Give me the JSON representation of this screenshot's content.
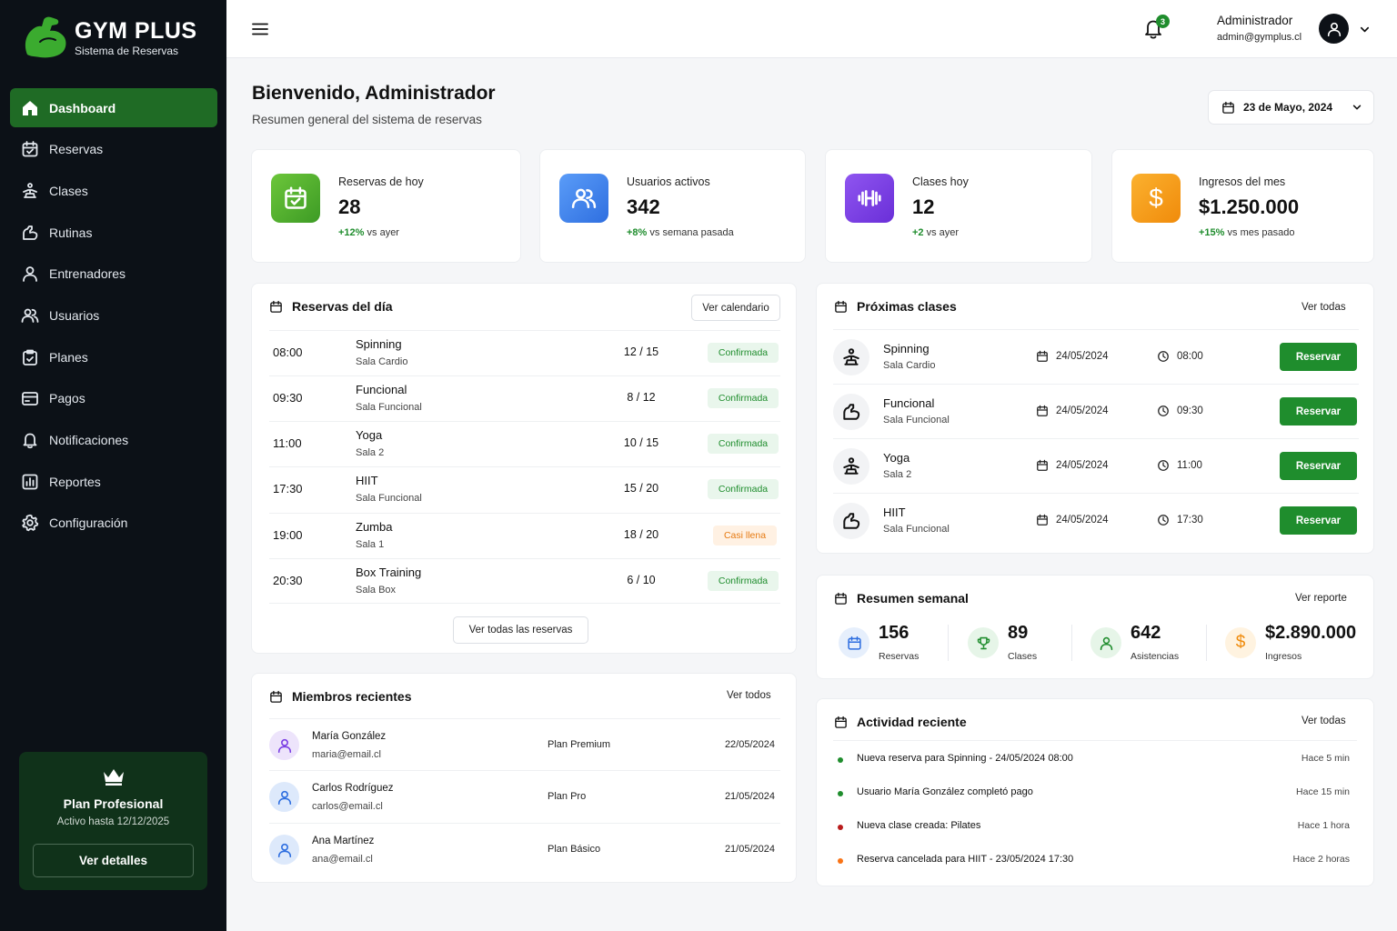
{
  "brand": {
    "title": "GYM PLUS",
    "subtitle": "Sistema de Reservas"
  },
  "sidebar": {
    "items": [
      {
        "label": "Dashboard",
        "icon": "home-icon"
      },
      {
        "label": "Reservas",
        "icon": "calendar-icon"
      },
      {
        "label": "Clases",
        "icon": "exercise-icon"
      },
      {
        "label": "Rutinas",
        "icon": "muscle-icon"
      },
      {
        "label": "Entrenadores",
        "icon": "user-icon"
      },
      {
        "label": "Usuarios",
        "icon": "users-icon"
      },
      {
        "label": "Planes",
        "icon": "clipboard-icon"
      },
      {
        "label": "Pagos",
        "icon": "card-icon"
      },
      {
        "label": "Notificaciones",
        "icon": "bell-icon"
      },
      {
        "label": "Reportes",
        "icon": "chart-icon"
      },
      {
        "label": "Configuración",
        "icon": "gear-icon"
      }
    ],
    "plan": {
      "title": "Plan Profesional",
      "subtitle": "Activo hasta 12/12/2025",
      "button": "Ver detalles"
    }
  },
  "topbar": {
    "notifications": "3",
    "user_name": "Administrador",
    "user_email": "admin@gymplus.cl"
  },
  "header": {
    "title": "Bienvenido, Administrador",
    "subtitle": "Resumen general del sistema de reservas",
    "date": "23 de Mayo, 2024"
  },
  "stats": [
    {
      "label": "Reservas de hoy",
      "value": "28",
      "change": "+12%",
      "compare": "vs ayer",
      "color": "#4caf28"
    },
    {
      "label": "Usuarios activos",
      "value": "342",
      "change": "+8%",
      "compare": "vs semana pasada",
      "color": "#3b82f6"
    },
    {
      "label": "Clases hoy",
      "value": "12",
      "change": "+2",
      "compare": "vs ayer",
      "color": "#7b3fe4"
    },
    {
      "label": "Ingresos del mes",
      "value": "$1.250.000",
      "change": "+15%",
      "compare": "vs mes pasado",
      "color": "#f59e0b"
    }
  ],
  "reservas": {
    "title": "Reservas del día",
    "calendar_button": "Ver calendario",
    "all_button": "Ver todas las reservas",
    "rows": [
      {
        "time": "08:00",
        "class": "Spinning",
        "room": "Sala Cardio",
        "capacity": "12 / 15",
        "status": "Confirmada"
      },
      {
        "time": "09:30",
        "class": "Funcional",
        "room": "Sala Funcional",
        "capacity": "8 / 12",
        "status": "Confirmada"
      },
      {
        "time": "11:00",
        "class": "Yoga",
        "room": "Sala 2",
        "capacity": "10 / 15",
        "status": "Confirmada"
      },
      {
        "time": "17:30",
        "class": "HIIT",
        "room": "Sala Funcional",
        "capacity": "15 / 20",
        "status": "Confirmada"
      },
      {
        "time": "19:00",
        "class": "Zumba",
        "room": "Sala 1",
        "capacity": "18 / 20",
        "status": "Casi llena"
      },
      {
        "time": "20:30",
        "class": "Box Training",
        "room": "Sala Box",
        "capacity": "6 / 10",
        "status": "Confirmada"
      }
    ]
  },
  "miembros": {
    "title": "Miembros recientes",
    "link": "Ver todos",
    "rows": [
      {
        "name": "María González",
        "email": "maria@email.cl",
        "plan": "Plan Premium",
        "date": "22/05/2024"
      },
      {
        "name": "Carlos Rodríguez",
        "email": "carlos@email.cl",
        "plan": "Plan Pro",
        "date": "21/05/2024"
      },
      {
        "name": "Ana Martínez",
        "email": "ana@email.cl",
        "plan": "Plan Básico",
        "date": "21/05/2024"
      }
    ]
  },
  "proximas": {
    "title": "Próximas clases",
    "link": "Ver todas",
    "button": "Reservar",
    "rows": [
      {
        "class": "Spinning",
        "room": "Sala Cardio",
        "date": "24/05/2024",
        "time": "08:00"
      },
      {
        "class": "Funcional",
        "room": "Sala Funcional",
        "date": "24/05/2024",
        "time": "09:30"
      },
      {
        "class": "Yoga",
        "room": "Sala 2",
        "date": "24/05/2024",
        "time": "11:00"
      },
      {
        "class": "HIIT",
        "room": "Sala Funcional",
        "date": "24/05/2024",
        "time": "17:30"
      }
    ]
  },
  "semanal": {
    "title": "Resumen semanal",
    "link": "Ver reporte",
    "items": [
      {
        "value": "156",
        "label": "Reservas"
      },
      {
        "value": "89",
        "label": "Clases"
      },
      {
        "value": "642",
        "label": "Asistencias"
      },
      {
        "value": "$2.890.000",
        "label": "Ingresos"
      }
    ]
  },
  "actividad": {
    "title": "Actividad reciente",
    "link": "Ver todas",
    "rows": [
      {
        "text": "Nueva reserva para Spinning - 24/05/2024 08:00",
        "time": "Hace 5 min",
        "color": "#1f8d2d"
      },
      {
        "text": "Usuario María González completó pago",
        "time": "Hace 15 min",
        "color": "#1f8d2d"
      },
      {
        "text": "Nueva clase creada: Pilates",
        "time": "Hace 1 hora",
        "color": "#b91c1c"
      },
      {
        "text": "Reserva cancelada para HIIT - 23/05/2024 17:30",
        "time": "Hace 2 horas",
        "color": "#f97316"
      }
    ]
  }
}
